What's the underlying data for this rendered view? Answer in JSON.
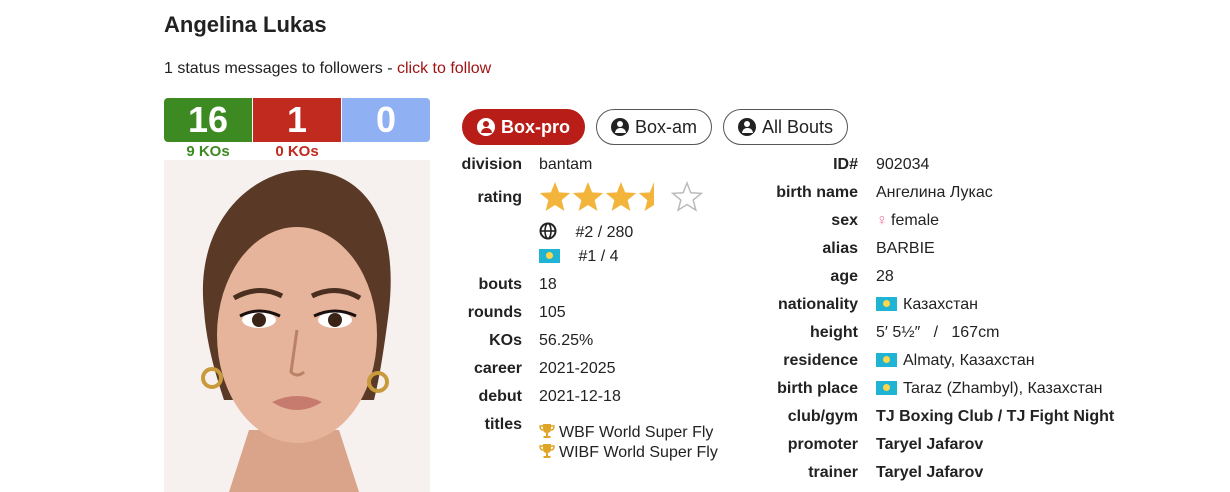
{
  "boxer": {
    "name": "Angelina Lukas",
    "status_prefix": "1 status messages to followers - ",
    "follow_link": "click to follow"
  },
  "record": {
    "wins": "16",
    "losses": "1",
    "draws": "0",
    "wins_kos": "9 KOs",
    "losses_kos": "0 KOs"
  },
  "tabs": [
    {
      "label": "Box-pro",
      "active": true
    },
    {
      "label": "Box-am",
      "active": false
    },
    {
      "label": "All Bouts",
      "active": false
    }
  ],
  "stats": {
    "division_label": "division",
    "division": "bantam",
    "rating_label": "rating",
    "rating_stars": 3.5,
    "rating_max": 5,
    "world_rank": "#2 / 280",
    "country_rank": "#1 / 4",
    "bouts_label": "bouts",
    "bouts": "18",
    "rounds_label": "rounds",
    "rounds": "105",
    "kos_label": "KOs",
    "kos": "56.25%",
    "career_label": "career",
    "career": "2021-2025",
    "debut_label": "debut",
    "debut": "2021-12-18",
    "titles_label": "titles",
    "titles": [
      "WBF World Super Fly",
      "WIBF World Super Fly"
    ]
  },
  "bio": {
    "id_label": "ID#",
    "id": "902034",
    "birth_name_label": "birth name",
    "birth_name": "Ангелина Лукас",
    "sex_label": "sex",
    "sex": "female",
    "alias_label": "alias",
    "alias": "BARBIE",
    "age_label": "age",
    "age": "28",
    "nationality_label": "nationality",
    "nationality": "Казахстан",
    "height_label": "height",
    "height": "5′ 5½″   /   167cm",
    "residence_label": "residence",
    "residence": "Almaty, Казахстан",
    "birth_place_label": "birth place",
    "birth_place": "Taraz (Zhambyl), Казахстан",
    "club_label": "club/gym",
    "club": "TJ Boxing Club / TJ Fight Night",
    "promoter_label": "promoter",
    "promoter": "Taryel Jafarov",
    "trainer_label": "trainer",
    "trainer": "Taryel Jafarov"
  },
  "colors": {
    "win": "#3d8a22",
    "loss": "#c02a1f",
    "draw": "#8fb0f3",
    "accent": "#b81e17",
    "star": "#f2b43a",
    "link": "#a01414"
  },
  "icons": {
    "tab": "user-circle-icon",
    "world": "globe-icon",
    "country": "kazakhstan-flag-icon",
    "title": "trophy-icon",
    "sex": "female-symbol-icon"
  }
}
